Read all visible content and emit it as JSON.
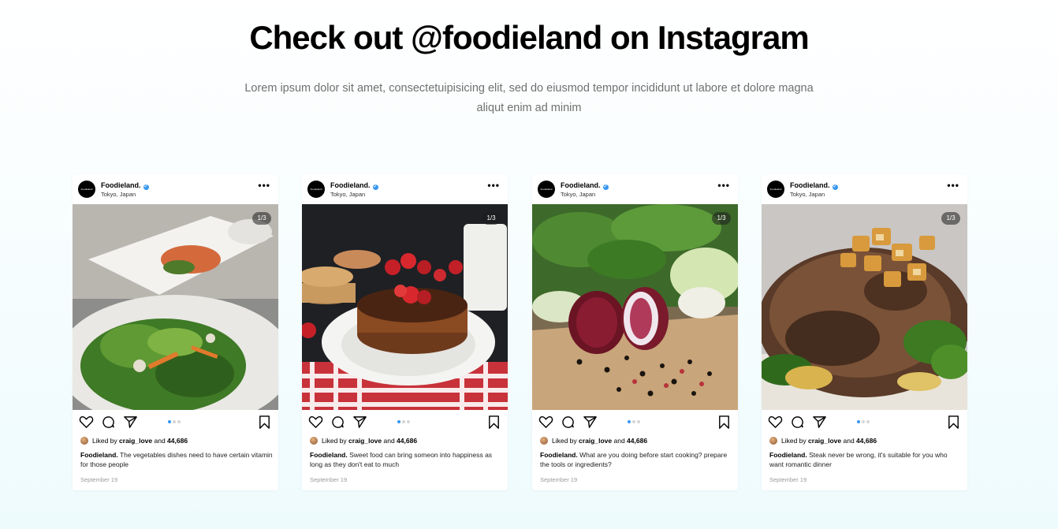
{
  "section": {
    "title": "Check out @foodieland on Instagram",
    "subtitle": "Lorem ipsum dolor sit amet, consectetuipisicing elit, sed do eiusmod tempor incididunt ut labore et dolore magna aliqut enim ad minim"
  },
  "colors": {
    "accent": "#3897f0",
    "card_bg": "#ffffff",
    "page_bg_bottom": "#eefbfd"
  },
  "posts": [
    {
      "username": "Foodieland.",
      "avatar_text": "Foodieland",
      "location": "Tokyo, Japan",
      "more_icon": "•••",
      "photo_counter": "1/3",
      "photo_subject": "salad-photo",
      "liked_prefix": "Liked by",
      "liked_user": "craig_love",
      "liked_and": "and",
      "like_count": "44,686",
      "caption_user": "Foodieland.",
      "caption_text": "The vegetables dishes need to have certain vitamin for those people",
      "date": "September 19",
      "carousel_dots": 3,
      "active_dot": 1
    },
    {
      "username": "Foodieland.",
      "avatar_text": "Foodieland",
      "location": "Tokyo, Japan",
      "more_icon": "•••",
      "photo_counter": "1/3",
      "photo_subject": "pancakes-photo",
      "liked_prefix": "Liked by",
      "liked_user": "craig_love",
      "liked_and": "and",
      "like_count": "44,686",
      "caption_user": "Foodieland.",
      "caption_text": "Sweet food can bring someon into happiness as long as they don't eat to much",
      "date": "September 19",
      "carousel_dots": 3,
      "active_dot": 1
    },
    {
      "username": "Foodieland.",
      "avatar_text": "Foodieland",
      "location": "Tokyo, Japan",
      "more_icon": "•••",
      "photo_counter": "1/3",
      "photo_subject": "onion-spices-photo",
      "liked_prefix": "Liked by",
      "liked_user": "craig_love",
      "liked_and": "and",
      "like_count": "44,686",
      "caption_user": "Foodieland.",
      "caption_text": "What are you doing before start cooking? prepare the  tools or ingredients?",
      "date": "September 19",
      "carousel_dots": 3,
      "active_dot": 1
    },
    {
      "username": "Foodieland.",
      "avatar_text": "Foodieland",
      "location": "Tokyo, Japan",
      "more_icon": "•••",
      "photo_counter": "1/3",
      "photo_subject": "steak-photo",
      "liked_prefix": "Liked by",
      "liked_user": "craig_love",
      "liked_and": "and",
      "like_count": "44,686",
      "caption_user": "Foodieland.",
      "caption_text": "Steak never be wrong, it's suitable for you who want romantic dinner",
      "date": "September 19",
      "carousel_dots": 3,
      "active_dot": 1
    }
  ],
  "icons": {
    "like": "heart-icon",
    "comment": "comment-icon",
    "share": "send-icon",
    "save": "bookmark-icon",
    "verified": "verified-badge-icon",
    "more": "more-options-icon"
  }
}
